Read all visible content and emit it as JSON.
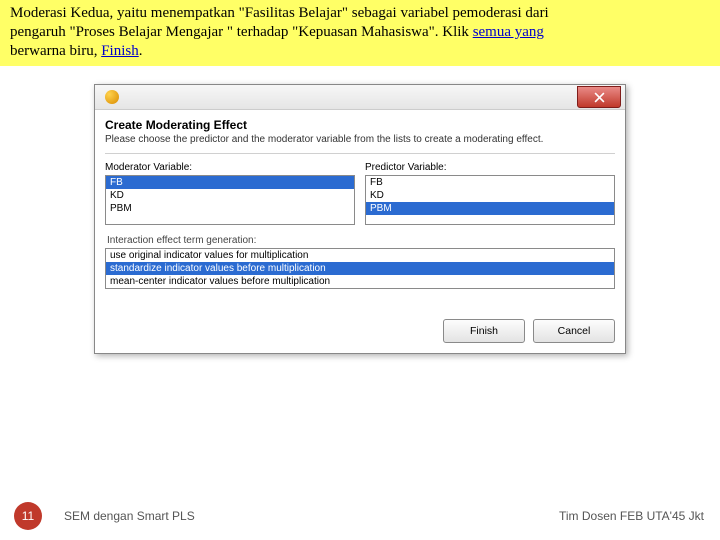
{
  "instruction": {
    "line1a": "Moderasi Kedua, yaitu menempatkan \"Fasilitas Belajar\"  sebagai variabel pemoderasi dari",
    "line2a": "pengaruh \"Proses Belajar Mengajar \" terhadap \"Kepuasan Mahasiswa\". Klik ",
    "link1": "semua yang",
    "line3a": "berwarna biru, Finish.",
    "linkFinish": "Finish"
  },
  "dialog": {
    "title": "Create Moderating Effect",
    "subtitle": "Please choose the predictor and the moderator variable from the lists to create a moderating effect.",
    "moderator": {
      "label": "Moderator Variable:",
      "items": [
        "FB",
        "KD",
        "PBM"
      ],
      "selected": 0
    },
    "predictor": {
      "label": "Predictor Variable:",
      "items": [
        "FB",
        "KD",
        "PBM"
      ],
      "selected": 2
    },
    "gen": {
      "label": "Interaction effect term generation:",
      "items": [
        "use original indicator values for multiplication",
        "standardize indicator values before multiplication",
        "mean-center indicator values before multiplication"
      ],
      "selected": 1
    },
    "buttons": {
      "finish": "Finish",
      "cancel": "Cancel"
    }
  },
  "footer": {
    "slide": "11",
    "left": "SEM dengan Smart PLS",
    "right": "Tim Dosen FEB UTA'45 Jkt"
  }
}
